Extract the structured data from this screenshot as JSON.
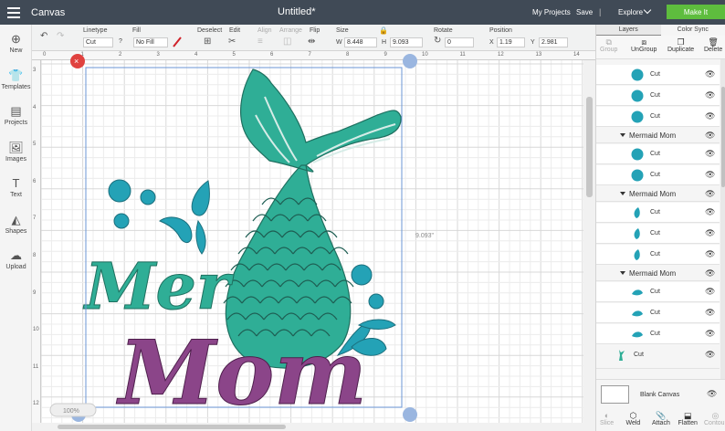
{
  "topbar": {
    "app_name": "Canvas",
    "document_title": "Untitled*",
    "my_projects": "My Projects",
    "save": "Save",
    "separator": "|",
    "explore": "Explore",
    "make_it": "Make It"
  },
  "toolbar": {
    "linetype_label": "Linetype",
    "linetype_value": "Cut",
    "fill_label": "Fill",
    "fill_value": "No Fill",
    "deselect_label": "Deselect",
    "edit_label": "Edit",
    "align_label": "Align",
    "arrange_label": "Arrange",
    "flip_label": "Flip",
    "size_label": "Size",
    "w_label": "W",
    "w_value": "8.448",
    "h_label": "H",
    "h_value": "9.093",
    "rotate_label": "Rotate",
    "rotate_value": "0",
    "position_label": "Position",
    "x_label": "X",
    "x_value": "1.19",
    "y_label": "Y",
    "y_value": "2.981"
  },
  "sidebar": [
    {
      "label": "New",
      "icon": "plus-icon"
    },
    {
      "label": "Templates",
      "icon": "shirt-icon"
    },
    {
      "label": "Projects",
      "icon": "projects-icon"
    },
    {
      "label": "Images",
      "icon": "images-icon"
    },
    {
      "label": "Text",
      "icon": "text-icon"
    },
    {
      "label": "Shapes",
      "icon": "shapes-icon"
    },
    {
      "label": "Upload",
      "icon": "upload-icon"
    }
  ],
  "rulers": {
    "top": [
      "0",
      "1",
      "2",
      "3",
      "4",
      "5",
      "6",
      "7",
      "8",
      "9",
      "10",
      "11",
      "12",
      "13",
      "14"
    ],
    "left": [
      "3",
      "4",
      "5",
      "6",
      "7",
      "8",
      "9",
      "10",
      "11",
      "12"
    ]
  },
  "canvas": {
    "height_readout": "9.093\"",
    "zoom": "100%"
  },
  "artwork": {
    "word1": "Mer",
    "word2": "Mom"
  },
  "panel": {
    "tabs": [
      "Layers",
      "Color Sync"
    ],
    "actions": [
      "Group",
      "UnGroup",
      "Duplicate",
      "Delete"
    ],
    "layer_rows": [
      {
        "kind": "item",
        "shape": "circle",
        "label": "Cut"
      },
      {
        "kind": "item",
        "shape": "circle",
        "label": "Cut"
      },
      {
        "kind": "item",
        "shape": "circle",
        "label": "Cut"
      },
      {
        "kind": "group",
        "label": "Mermaid Mom"
      },
      {
        "kind": "item",
        "shape": "circle",
        "label": "Cut"
      },
      {
        "kind": "item",
        "shape": "circle",
        "label": "Cut"
      },
      {
        "kind": "group",
        "label": "Mermaid Mom"
      },
      {
        "kind": "item",
        "shape": "drop",
        "label": "Cut"
      },
      {
        "kind": "item",
        "shape": "drop",
        "label": "Cut"
      },
      {
        "kind": "item",
        "shape": "drop",
        "label": "Cut"
      },
      {
        "kind": "group",
        "label": "Mermaid Mom"
      },
      {
        "kind": "item",
        "shape": "splash",
        "label": "Cut"
      },
      {
        "kind": "item",
        "shape": "splash",
        "label": "Cut"
      },
      {
        "kind": "item",
        "shape": "splash",
        "label": "Cut"
      },
      {
        "kind": "item",
        "shape": "tail",
        "label": "Cut"
      }
    ],
    "blank_canvas": "Blank Canvas",
    "bottom_actions": [
      "Slice",
      "Weld",
      "Attach",
      "Flatten",
      "Contour"
    ]
  },
  "colors": {
    "teal": "#24a2b6",
    "mermaid_green": "#2fae96",
    "purple": "#8b4589",
    "topbar": "#404a56",
    "make_it_green": "#5ebd3e"
  }
}
